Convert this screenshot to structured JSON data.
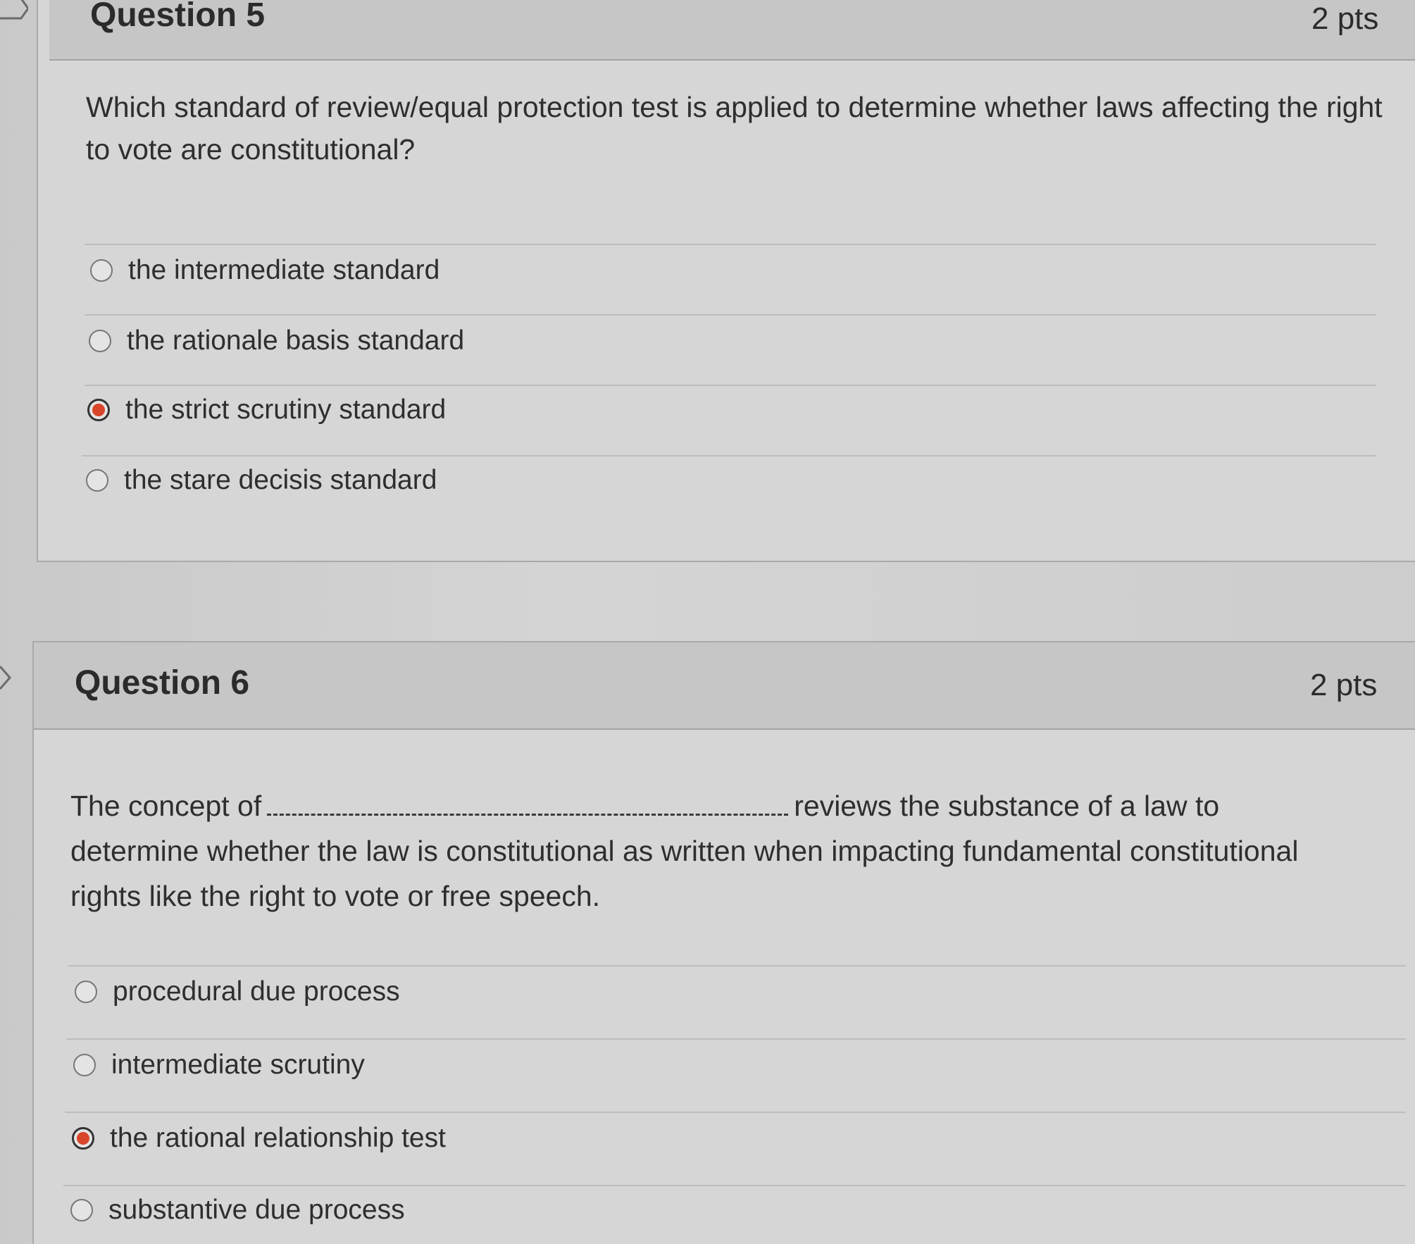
{
  "q5": {
    "title": "Question 5",
    "points": "2 pts",
    "text": "Which standard of review/equal protection test is applied to determine whether laws affecting the right to vote are constitutional?",
    "answers": [
      {
        "label": "the intermediate standard",
        "selected": false
      },
      {
        "label": "the rationale basis standard",
        "selected": false
      },
      {
        "label": "the strict scrutiny standard",
        "selected": true
      },
      {
        "label": "the stare decisis standard",
        "selected": false
      }
    ]
  },
  "q6": {
    "title": "Question 6",
    "points": "2 pts",
    "text_before": "The concept of",
    "text_after": "reviews the substance of a law to",
    "text_line2": "determine whether the law is constitutional as written when impacting fundamental constitutional",
    "text_line3": "rights like the right to vote or free speech.",
    "answers": [
      {
        "label": "procedural due process",
        "selected": false
      },
      {
        "label": "intermediate scrutiny",
        "selected": false
      },
      {
        "label": "the rational relationship test",
        "selected": true
      },
      {
        "label": "substantive due process",
        "selected": false
      }
    ]
  },
  "colors": {
    "selected_radio": "#d9452a",
    "background": "#cfcfcf"
  },
  "icons": {
    "flag": "flag-icon"
  }
}
